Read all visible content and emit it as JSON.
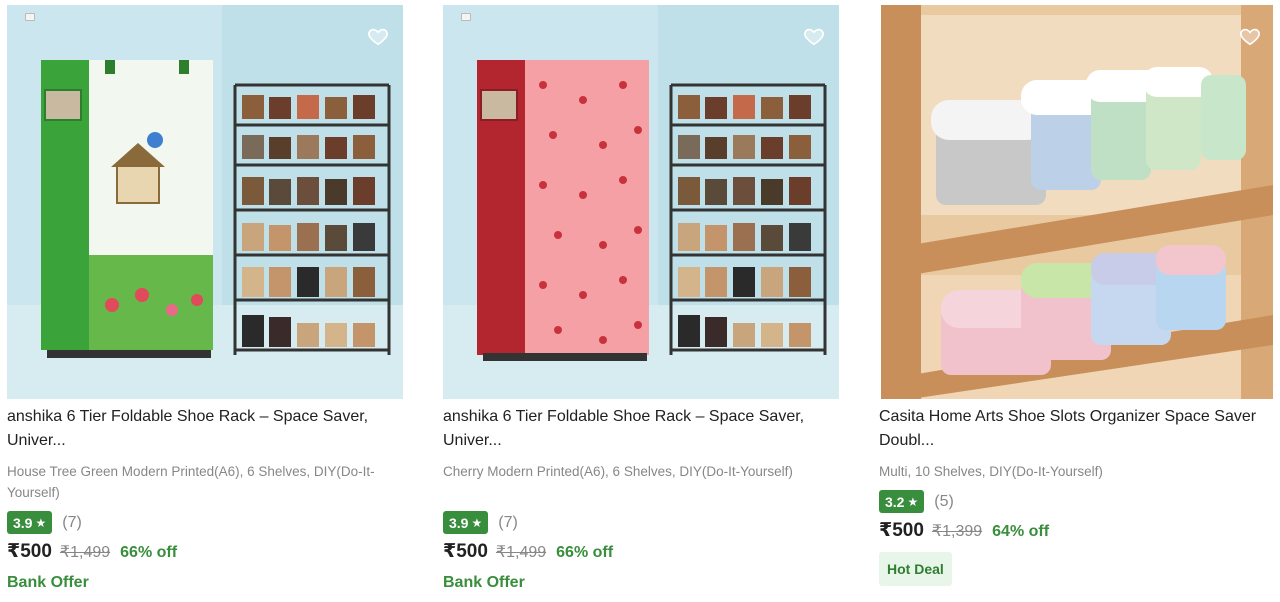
{
  "products": [
    {
      "title": "anshika 6 Tier Foldable Shoe Rack – Space Saver, Univer...",
      "subtitle": "House Tree Green Modern Printed(A6), 6 Shelves, DIY(Do-It-Yourself)",
      "rating": "3.9",
      "rating_count": "(7)",
      "price": "₹500",
      "mrp": "₹1,499",
      "discount": "66% off",
      "offer": "Bank Offer",
      "cover_color": "#3aa33a",
      "icons": [
        "wishlist-heart-icon",
        "star-icon"
      ]
    },
    {
      "title": "anshika 6 Tier Foldable Shoe Rack – Space Saver, Univer...",
      "subtitle": "Cherry Modern Printed(A6), 6 Shelves, DIY(Do-It-Yourself)",
      "rating": "3.9",
      "rating_count": "(7)",
      "price": "₹500",
      "mrp": "₹1,499",
      "discount": "66% off",
      "offer": "Bank Offer",
      "cover_color": "#b3262f",
      "icons": [
        "wishlist-heart-icon",
        "star-icon"
      ]
    },
    {
      "title": "Casita Home Arts Shoe Slots Organizer Space Saver Doubl...",
      "subtitle": "Multi, 10 Shelves, DIY(Do-It-Yourself)",
      "rating": "3.2",
      "rating_count": "(5)",
      "price": "₹500",
      "mrp": "₹1,399",
      "discount": "64% off",
      "badge": "Hot Deal",
      "icons": [
        "wishlist-heart-icon",
        "star-icon"
      ]
    }
  ],
  "colors": {
    "rating_green": "#388e3c",
    "discount_green": "#388e3c",
    "muted_text": "#878787",
    "hot_deal_bg": "#e8f5e9"
  }
}
